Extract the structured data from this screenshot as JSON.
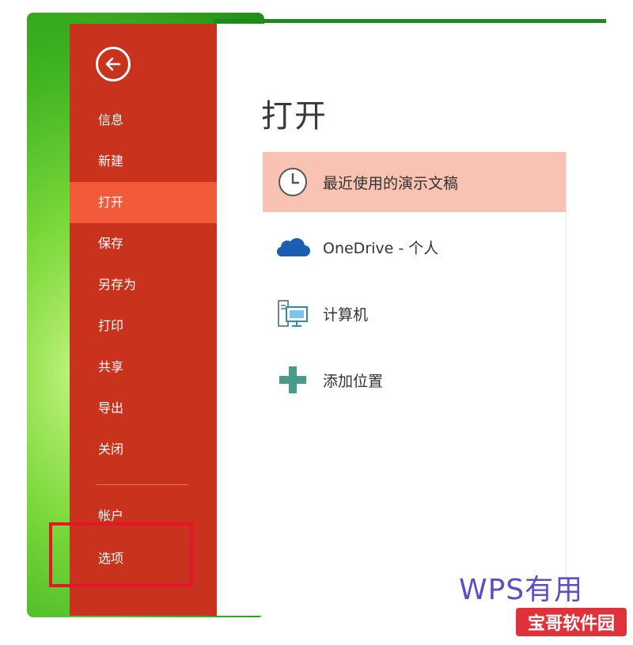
{
  "sidebar": {
    "items": [
      {
        "label": "信息"
      },
      {
        "label": "新建"
      },
      {
        "label": "打开"
      },
      {
        "label": "保存"
      },
      {
        "label": "另存为"
      },
      {
        "label": "打印"
      },
      {
        "label": "共享"
      },
      {
        "label": "导出"
      },
      {
        "label": "关闭"
      },
      {
        "label": "帐户"
      },
      {
        "label": "选项"
      }
    ],
    "active_index": 2
  },
  "main": {
    "title": "打开",
    "locations": [
      {
        "label": "最近使用的演示文稿",
        "icon": "clock-icon"
      },
      {
        "label": "OneDrive - 个人",
        "icon": "cloud-icon"
      },
      {
        "label": "计算机",
        "icon": "computer-icon"
      },
      {
        "label": "添加位置",
        "icon": "plus-icon"
      }
    ]
  },
  "watermarks": {
    "wps": "WPS有用",
    "site": "宝哥软件园"
  },
  "colors": {
    "sidebar": "#c9321c",
    "active_item": "#f25b3a",
    "selected_location": "#f9c3b3",
    "highlight_box": "#e8152a"
  }
}
